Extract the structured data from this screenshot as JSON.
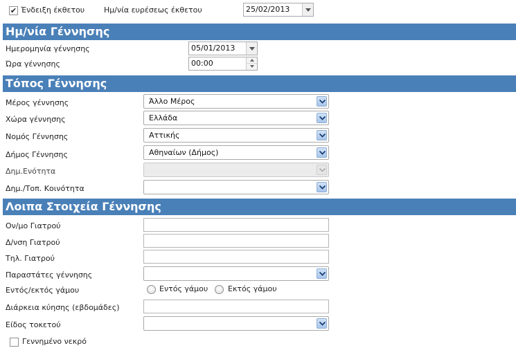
{
  "top": {
    "display_checkbox_label": "Ένδειξη έκθετου",
    "display_checked": true,
    "found_date_label": "Ημ/νία ευρέσεως έκθετου",
    "found_date_value": "25/02/2013"
  },
  "birth_date_section": {
    "title": "Ημ/νία Γέννησης",
    "date_label": "Ημερομηνία γέννησης",
    "date_value": "05/01/2013",
    "time_label": "Ώρα γέννησης",
    "time_value": "00:00"
  },
  "birth_place_section": {
    "title": "Τόπος Γέννησης",
    "place_label": "Μέρος γέννησης",
    "place_value": "Άλλο Μέρος",
    "country_label": "Χώρα γέννησης",
    "country_value": "Ελλάδα",
    "prefecture_label": "Νομός Γέννησης",
    "prefecture_value": "Αττικής",
    "municipality_label": "Δήμος Γέννησης",
    "municipality_value": "Αθηναίων (Δήμος)",
    "unit_label": "Δημ.Ενότητα",
    "unit_value": "",
    "community_label": "Δημ./Τοπ. Κοινότητα",
    "community_value": ""
  },
  "other_section": {
    "title": "Λοιπα Στοιχεία Γέννησης",
    "doctor_name_label": "Ον/μο Γιατρού",
    "doctor_name_value": "",
    "doctor_address_label": "Δ/νση Γιατρού",
    "doctor_address_value": "",
    "doctor_phone_label": "Τηλ. Γιατρού",
    "doctor_phone_value": "",
    "attendants_label": "Παραστάτες γέννησης",
    "attendants_value": "",
    "marriage_label": "Εντός/εκτός γάμου",
    "marriage_option_in": "Εντός γάμου",
    "marriage_option_out": "Εκτός γάμου",
    "pregnancy_label": "Διάρκεια κύησης (εβδομάδες)",
    "pregnancy_value": "",
    "delivery_label": "Είδος τοκετού",
    "delivery_value": "",
    "stillborn_label": "Γεννημένο νεκρό",
    "stillborn_checked": false
  },
  "colors": {
    "section_header_bg": "#4a80b8",
    "section_header_text": "#ffffff",
    "dropdown_button": "#a9c6ea"
  },
  "icons": {
    "dropdown": "chevron-down-icon",
    "spin_up": "caret-up-icon",
    "spin_down": "caret-down-icon",
    "check": "checkmark-icon"
  }
}
